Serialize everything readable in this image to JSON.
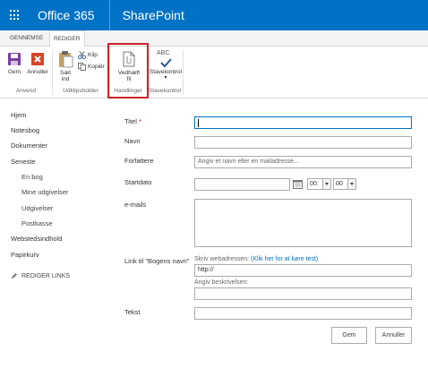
{
  "suitebar": {
    "brand": "Office 365",
    "app": "SharePoint",
    "waffle_icon": "app-launcher-icon",
    "bg_color": "#0072c6"
  },
  "ribbon_tabs": [
    "GENNEMSE",
    "REDIGER"
  ],
  "ribbon": {
    "save": "Gem",
    "cancel": "Annuller",
    "group_commit": "Anvend",
    "paste_line1": "Sæt",
    "paste_line2": "ind",
    "cut": "Klip",
    "copy": "Kopiér",
    "group_clipboard": "Udklipsholder",
    "attach_line1": "Vedhæft",
    "attach_line2": "fil",
    "group_actions": "Handlinger",
    "spell_icon_text": "ABC",
    "spelling": "Stavekontrol",
    "spelling_arrow": "▾",
    "group_spelling": "Stavekontrol"
  },
  "leftnav": {
    "items": [
      "Hjem",
      "Notesbog",
      "Dokumenter",
      "Seneste"
    ],
    "sub_items": [
      "En bog",
      "Mine udgivelser",
      "Udgivelser",
      "Postkasse"
    ],
    "bottom_items": [
      "Webstedsindhold",
      "Papirkurv"
    ],
    "edit_links": "REDIGER LINKS"
  },
  "form": {
    "title_label": "Titel",
    "required_mark": "*",
    "name_label": "Navn",
    "authors_label": "Forfattere",
    "authors_placeholder": "Angiv et navn eller en mailadresse...",
    "startdate_label": "Startdato",
    "hour_value": "00:",
    "minute_value": "00",
    "emails_label": "e-mails",
    "link_label": "Link til \"Bogens navn\"",
    "link_hint": "Skriv webadressen:",
    "link_test": "(Klik her for at køre test)",
    "url_value": "http://",
    "desc_hint": "Angiv beskrivelsen:",
    "text_label": "Tekst",
    "save_button": "Gem",
    "cancel_button": "Annuller"
  }
}
